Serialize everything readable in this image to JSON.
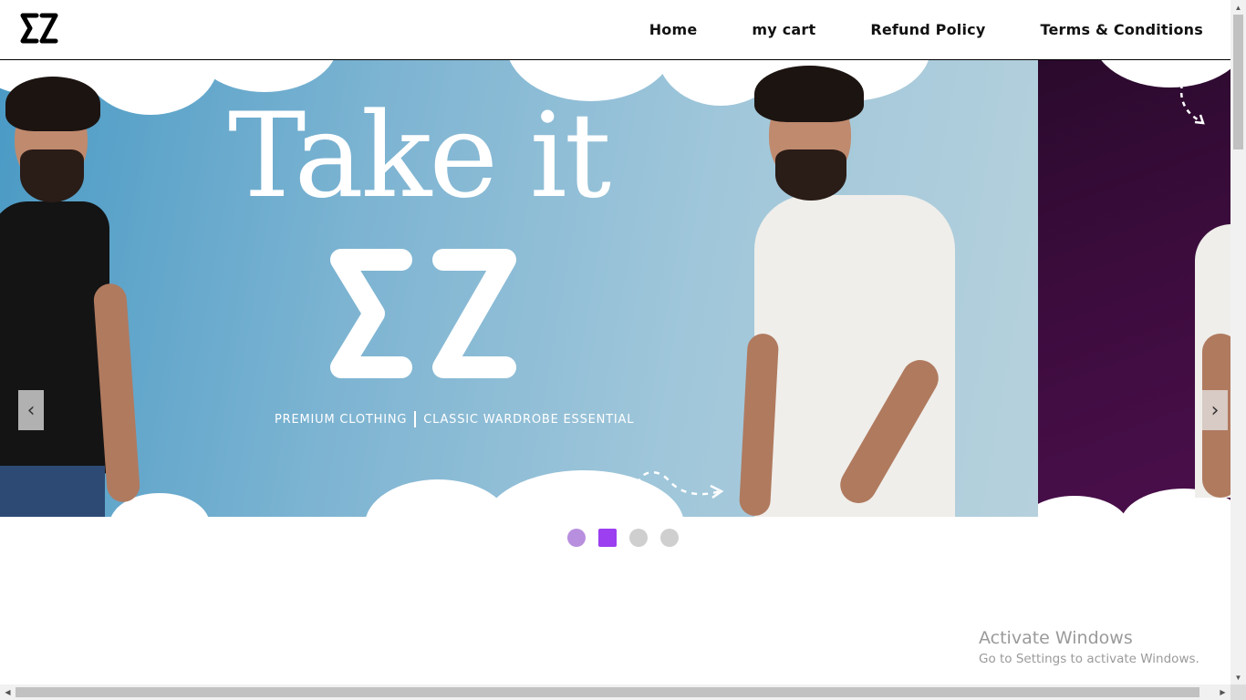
{
  "brand": {
    "logo_text": "ΣZ"
  },
  "nav": {
    "items": [
      {
        "label": "Home"
      },
      {
        "label": "my cart"
      },
      {
        "label": "Refund Policy"
      },
      {
        "label": "Terms & Conditions"
      }
    ]
  },
  "hero": {
    "headline": "Take it",
    "logo_text": "ΣZ",
    "tagline_left": "PREMIUM CLOTHING",
    "tagline_right": "CLASSIC WARDROBE ESSENTIAL",
    "prev_label": "‹",
    "next_label": "›",
    "colors": {
      "slide_bg": "#7db4d2",
      "next_slide_bg": "#3d0c3e"
    }
  },
  "carousel": {
    "slide_count": 4,
    "active_index": 1,
    "colors": {
      "active": "#9b3ff0",
      "hover": "#b88fdf",
      "inactive": "#cfcfcf"
    }
  },
  "watermark": {
    "title": "Activate Windows",
    "subtitle": "Go to Settings to activate Windows."
  }
}
